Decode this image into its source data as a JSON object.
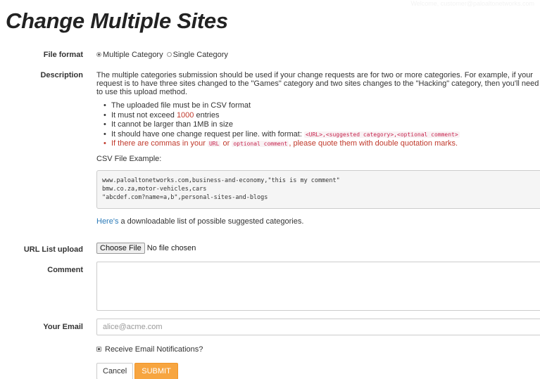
{
  "header": {
    "welcome": "Welcome, customer@paloaltonetworks.com",
    "title": "Change Multiple Sites"
  },
  "file_format": {
    "label": "File format",
    "options": [
      {
        "label": "Multiple Category",
        "checked": true
      },
      {
        "label": "Single Category",
        "checked": false
      }
    ]
  },
  "description": {
    "label": "Description",
    "intro": "The multiple categories submission should be used if your change requests are for two or more categories. For example, if your request is to have three sites changed to the \"Games\" category and two sites changes to the \"Hacking\" category, then you'll need to use this upload method.",
    "rules": {
      "r1": "The uploaded file must be in CSV format",
      "r2_pre": "It must not exceed ",
      "r2_num": "1000",
      "r2_post": " entries",
      "r3": "It cannot be larger than 1MB in size",
      "r4_pre": "It should have one change request per line. with format: ",
      "r4_code": "<URL>,<suggested category>,<optional comment>",
      "r5_pre": "If there are commas in your ",
      "r5_code1": "URL",
      "r5_mid": " or ",
      "r5_code2": "optional comment",
      "r5_post": ", please quote them with double quotation marks."
    },
    "csv_label": "CSV File Example:",
    "csv_example": "www.paloaltonetworks.com,business-and-economy,\"this is my comment\"\nbmw.co.za,motor-vehicles,cars\n\"abcdef.com?name=a,b\",personal-sites-and-blogs",
    "link_text": "Here's",
    "link_suffix": " a downloadable list of possible suggested categories."
  },
  "url_upload": {
    "label": "URL List upload",
    "button": "Choose File",
    "status": "No file chosen"
  },
  "comment": {
    "label": "Comment",
    "value": ""
  },
  "email": {
    "label": "Your Email",
    "placeholder": "alice@acme.com",
    "value": ""
  },
  "notifications": {
    "label": "Receive Email Notifications?",
    "checked": true
  },
  "actions": {
    "cancel": "Cancel",
    "submit": "SUBMIT"
  },
  "colors": {
    "submit": "#f7a540",
    "link": "#2a7ab8",
    "warning": "#c0392b"
  }
}
